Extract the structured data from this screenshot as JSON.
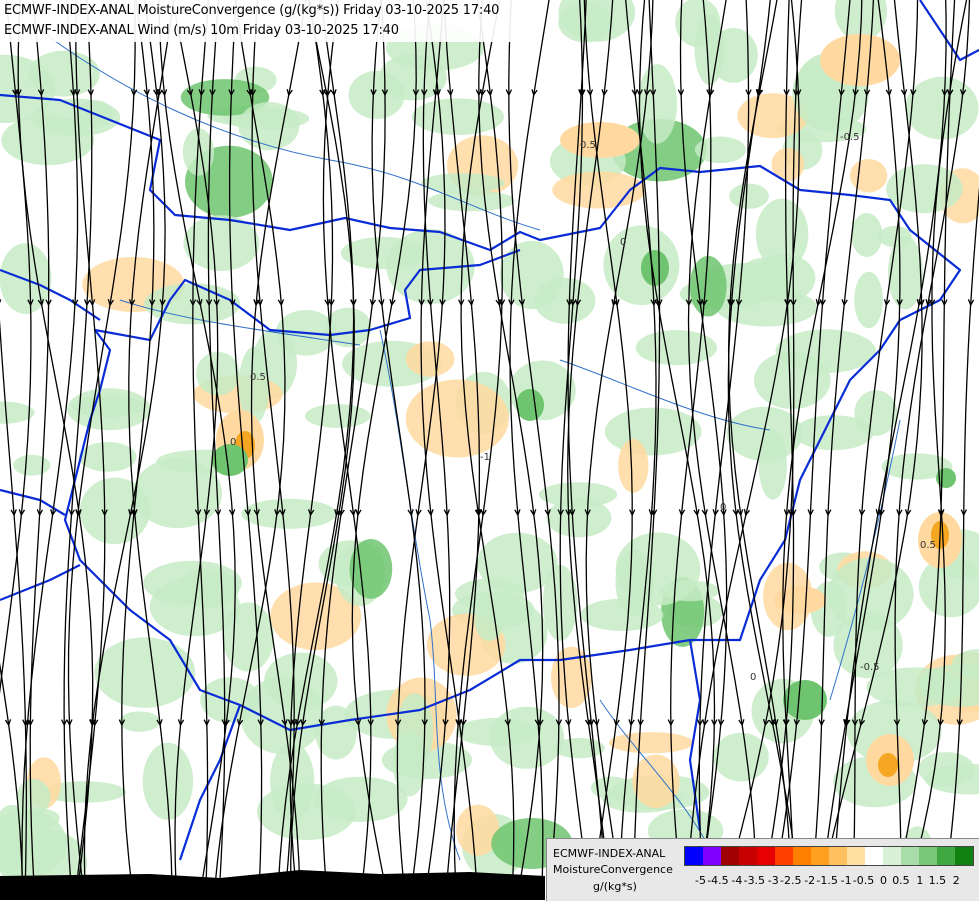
{
  "header": {
    "line1": "ECMWF-INDEX-ANAL MoistureConvergence (g/(kg*s)) Friday 03-10-2025 17:40",
    "line2": "ECMWF-INDEX-ANAL Wind (m/s) 10m Friday 03-10-2025 17:40"
  },
  "legend": {
    "title1": "ECMWF-INDEX-ANAL",
    "title2": "MoistureConvergence",
    "unit": "g/(kg*s)",
    "colors": [
      "#0000ff",
      "#8000ff",
      "#a00000",
      "#c80000",
      "#e60000",
      "#ff4000",
      "#ff8000",
      "#ffa020",
      "#ffc060",
      "#ffe0a0",
      "#ffffff",
      "#d8f0d8",
      "#a8dca8",
      "#78c878",
      "#40a840",
      "#108010"
    ],
    "labels": [
      "-5",
      "-4.5",
      "-4",
      "-3.5",
      "-3",
      "-2.5",
      "-2",
      "-1.5",
      "-1",
      "-0.5",
      "0",
      "0.5",
      "1",
      "1.5",
      "2"
    ]
  },
  "map": {
    "land_color": "#ffffff",
    "sea_color": "#000000",
    "convergence_light_color": "#c6ebc6",
    "convergence_strong_color": "#6fc46f",
    "divergence_color": "#ffd9a0",
    "divergence_strong_color": "#f5a623",
    "border_color": "#0a2cd6",
    "river_color": "#3070c8",
    "streamline_color": "#000000",
    "contour_labels": [
      "0",
      "0.5",
      "-0.5",
      "-1",
      "0",
      "0.5",
      "0",
      "-0.5",
      "0.5",
      "0"
    ]
  }
}
